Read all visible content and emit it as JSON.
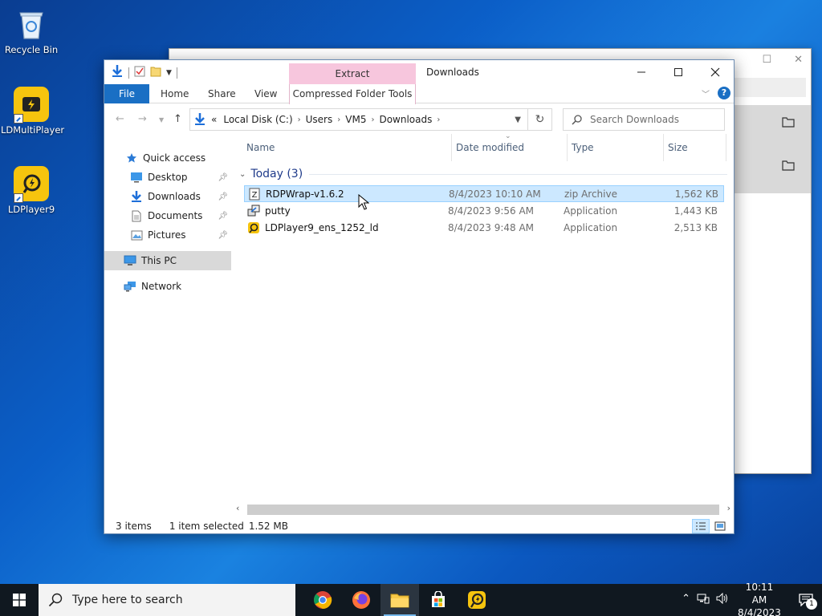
{
  "desktop": {
    "icons": [
      {
        "label": "Recycle Bin",
        "icon": "recycle-bin-icon"
      },
      {
        "label": "LDMultiPlayer",
        "icon": "ldmultiplayer-icon"
      },
      {
        "label": "LDPlayer9",
        "icon": "ldplayer-icon"
      }
    ]
  },
  "window": {
    "title": "Downloads",
    "context_tab": "Extract",
    "ribbon": {
      "file": "File",
      "home": "Home",
      "share": "Share",
      "view": "View",
      "context": "Compressed Folder Tools"
    },
    "address": {
      "prefix": "«",
      "crumbs": [
        "Local Disk (C:)",
        "Users",
        "VM5",
        "Downloads"
      ]
    },
    "search_placeholder": "Search Downloads",
    "nav": {
      "quick_access": "Quick access",
      "items": [
        {
          "label": "Desktop",
          "icon": "desktop-icon",
          "pinned": true
        },
        {
          "label": "Downloads",
          "icon": "downloads-icon",
          "pinned": true
        },
        {
          "label": "Documents",
          "icon": "documents-icon",
          "pinned": true
        },
        {
          "label": "Pictures",
          "icon": "pictures-icon",
          "pinned": true
        }
      ],
      "this_pc": "This PC",
      "network": "Network"
    },
    "columns": {
      "name": "Name",
      "date": "Date modified",
      "type": "Type",
      "size": "Size"
    },
    "group": "Today (3)",
    "files": [
      {
        "name": "RDPWrap-v1.6.2",
        "date": "8/4/2023 10:10 AM",
        "type": "zip Archive",
        "size": "1,562 KB",
        "selected": true,
        "icon": "zip-archive-icon"
      },
      {
        "name": "putty",
        "date": "8/4/2023 9:56 AM",
        "type": "Application",
        "size": "1,443 KB",
        "selected": false,
        "icon": "putty-icon"
      },
      {
        "name": "LDPlayer9_ens_1252_ld",
        "date": "8/4/2023 9:48 AM",
        "type": "Application",
        "size": "2,513 KB",
        "selected": false,
        "icon": "ldplayer-installer-icon"
      }
    ],
    "status": {
      "count": "3 items",
      "selected": "1 item selected",
      "size": "1.52 MB"
    }
  },
  "taskbar": {
    "search_placeholder": "Type here to search",
    "apps": [
      "chrome-icon",
      "firefox-icon",
      "file-explorer-icon",
      "store-icon",
      "ldplayer-icon"
    ],
    "time": "10:11 AM",
    "date": "8/4/2023",
    "notification_count": "1"
  },
  "colors": {
    "accent": "#1a6fc4",
    "context_tab": "#f7c6dd",
    "selection": "#cce8ff",
    "ld_yellow": "#f6c40e"
  }
}
